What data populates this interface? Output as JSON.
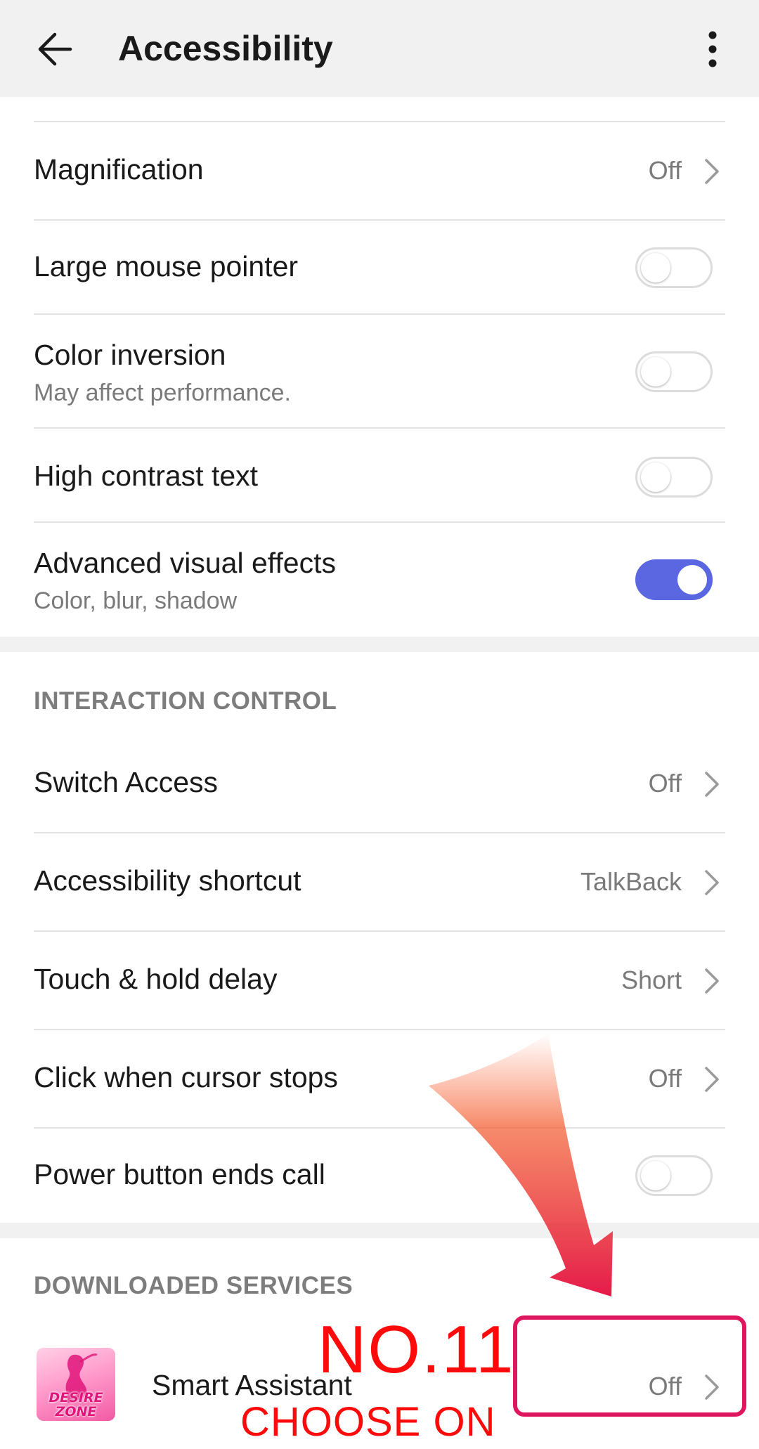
{
  "header": {
    "title": "Accessibility",
    "back_icon": "back-arrow-icon",
    "more_icon": "more-vert-icon"
  },
  "rows": {
    "magnification": {
      "title": "Magnification",
      "value": "Off"
    },
    "large_mouse_pointer": {
      "title": "Large mouse pointer",
      "toggle": false
    },
    "color_inversion": {
      "title": "Color inversion",
      "subtitle": "May affect performance.",
      "toggle": false
    },
    "high_contrast_text": {
      "title": "High contrast text",
      "toggle": false
    },
    "advanced_visual_effects": {
      "title": "Advanced visual effects",
      "subtitle": "Color, blur, shadow",
      "toggle": true
    }
  },
  "interaction_control": {
    "header": "INTERACTION CONTROL",
    "switch_access": {
      "title": "Switch Access",
      "value": "Off"
    },
    "accessibility_shortcut": {
      "title": "Accessibility shortcut",
      "value": "TalkBack"
    },
    "touch_hold_delay": {
      "title": "Touch & hold delay",
      "value": "Short"
    },
    "click_when_cursor_stops": {
      "title": "Click when cursor stops",
      "value": "Off"
    },
    "power_button_ends_call": {
      "title": "Power button ends call",
      "toggle": false
    }
  },
  "downloaded_services": {
    "header": "DOWNLOADED SERVICES",
    "smart_assistant": {
      "title": "Smart Assistant",
      "value": "Off",
      "icon_text_1": "DESIRE",
      "icon_text_2": "ZONE"
    }
  },
  "annotation": {
    "step": "NO.11",
    "instruction": "CHOOSE ON",
    "color": "#ff0a0a",
    "box_color": "#e0155f"
  },
  "colors": {
    "accent": "#5b67e0",
    "app_bar": "#f1f1f1",
    "secondary_text": "#7a7a7a"
  }
}
